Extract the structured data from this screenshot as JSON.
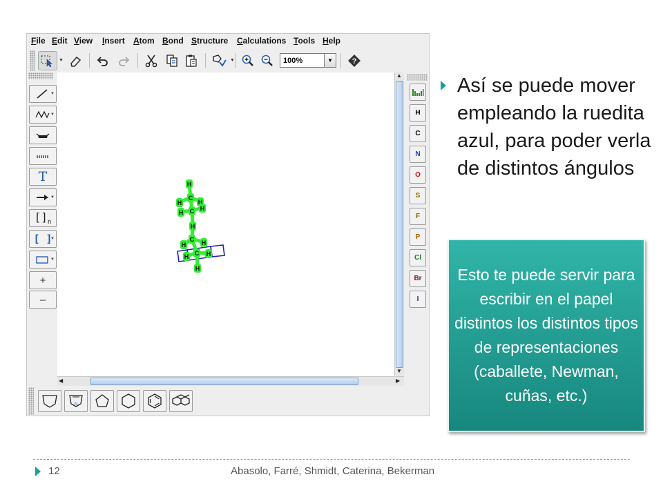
{
  "editor": {
    "menu": [
      {
        "mnemonic": "F",
        "rest": "ile"
      },
      {
        "mnemonic": "E",
        "rest": "dit"
      },
      {
        "mnemonic": "V",
        "rest": "iew"
      },
      {
        "mnemonic": "I",
        "rest": "nsert"
      },
      {
        "mnemonic": "A",
        "rest": "tom"
      },
      {
        "mnemonic": "B",
        "rest": "ond"
      },
      {
        "mnemonic": "S",
        "rest": "tructure"
      },
      {
        "mnemonic": "C",
        "rest": "alculations"
      },
      {
        "mnemonic": "T",
        "rest": "ools"
      },
      {
        "mnemonic": "H",
        "rest": "elp"
      }
    ],
    "toolbar": {
      "icons": [
        "select-icon",
        "eraser-icon",
        "undo-icon",
        "redo-icon",
        "cut-icon",
        "copy-icon",
        "paste-icon",
        "clean-icon",
        "zoom-in-icon",
        "zoom-out-icon",
        "help-icon"
      ],
      "zoom_value": "100%"
    },
    "left_tools": {
      "icons": [
        "single-bond-icon",
        "chain-icon",
        "bracket-bottom-icon",
        "dashed-bond-icon",
        "text-icon",
        "reaction-arrow-icon",
        "sgroup-icon",
        "bracket-icon",
        "rectangle-icon",
        "plus-icon",
        "minus-icon"
      ],
      "text_tool_label": "T",
      "sgroup_label": "[]",
      "sgroup_subscript": "n",
      "bracket_label": "[ ]",
      "plus_label": "+",
      "minus_label": "–"
    },
    "atoms": [
      "H",
      "C",
      "N",
      "O",
      "S",
      "F",
      "P",
      "Cl",
      "Br",
      "I"
    ],
    "atom_colors": {
      "H": "#000000",
      "C": "#000000",
      "N": "#1f3fbf",
      "O": "#d01010",
      "S": "#8a6a00",
      "F": "#8a6a00",
      "P": "#b06000",
      "Cl": "#1a7a1a",
      "Br": "#6a1a1a",
      "I": "#4a1a6a"
    },
    "molecule_labels": {
      "h1": "H",
      "c1": "C",
      "h2": "H",
      "h3": "H",
      "h4": "H",
      "h5": "H",
      "c2": "C",
      "h6": "H",
      "c3": "C",
      "h7": "H",
      "h8": "H",
      "c4": "C",
      "h9": "H",
      "h10": "H"
    },
    "molecule_highlight_color": "#33ee33",
    "selection_color": "#2020c0",
    "templates": [
      "cyclopropane-template-icon",
      "pyrrole-template-icon",
      "cyclopentane-template-icon",
      "cyclohexane-template-icon",
      "benzene-template-icon",
      "naphthalene-template-icon"
    ]
  },
  "slide": {
    "bullet": "Así se puede mover empleando la ruedita azul, para poder verla de distintos ángulos",
    "note": "Esto te puede servir para escribir en el papel distintos los distintos tipos de representaciones (caballete, Newman, cuñas, etc.)",
    "accent_color": "#1f9e93",
    "footer": {
      "page": "12",
      "authors": "Abasolo, Farré, Shmidt, Caterina, Bekerman"
    }
  }
}
